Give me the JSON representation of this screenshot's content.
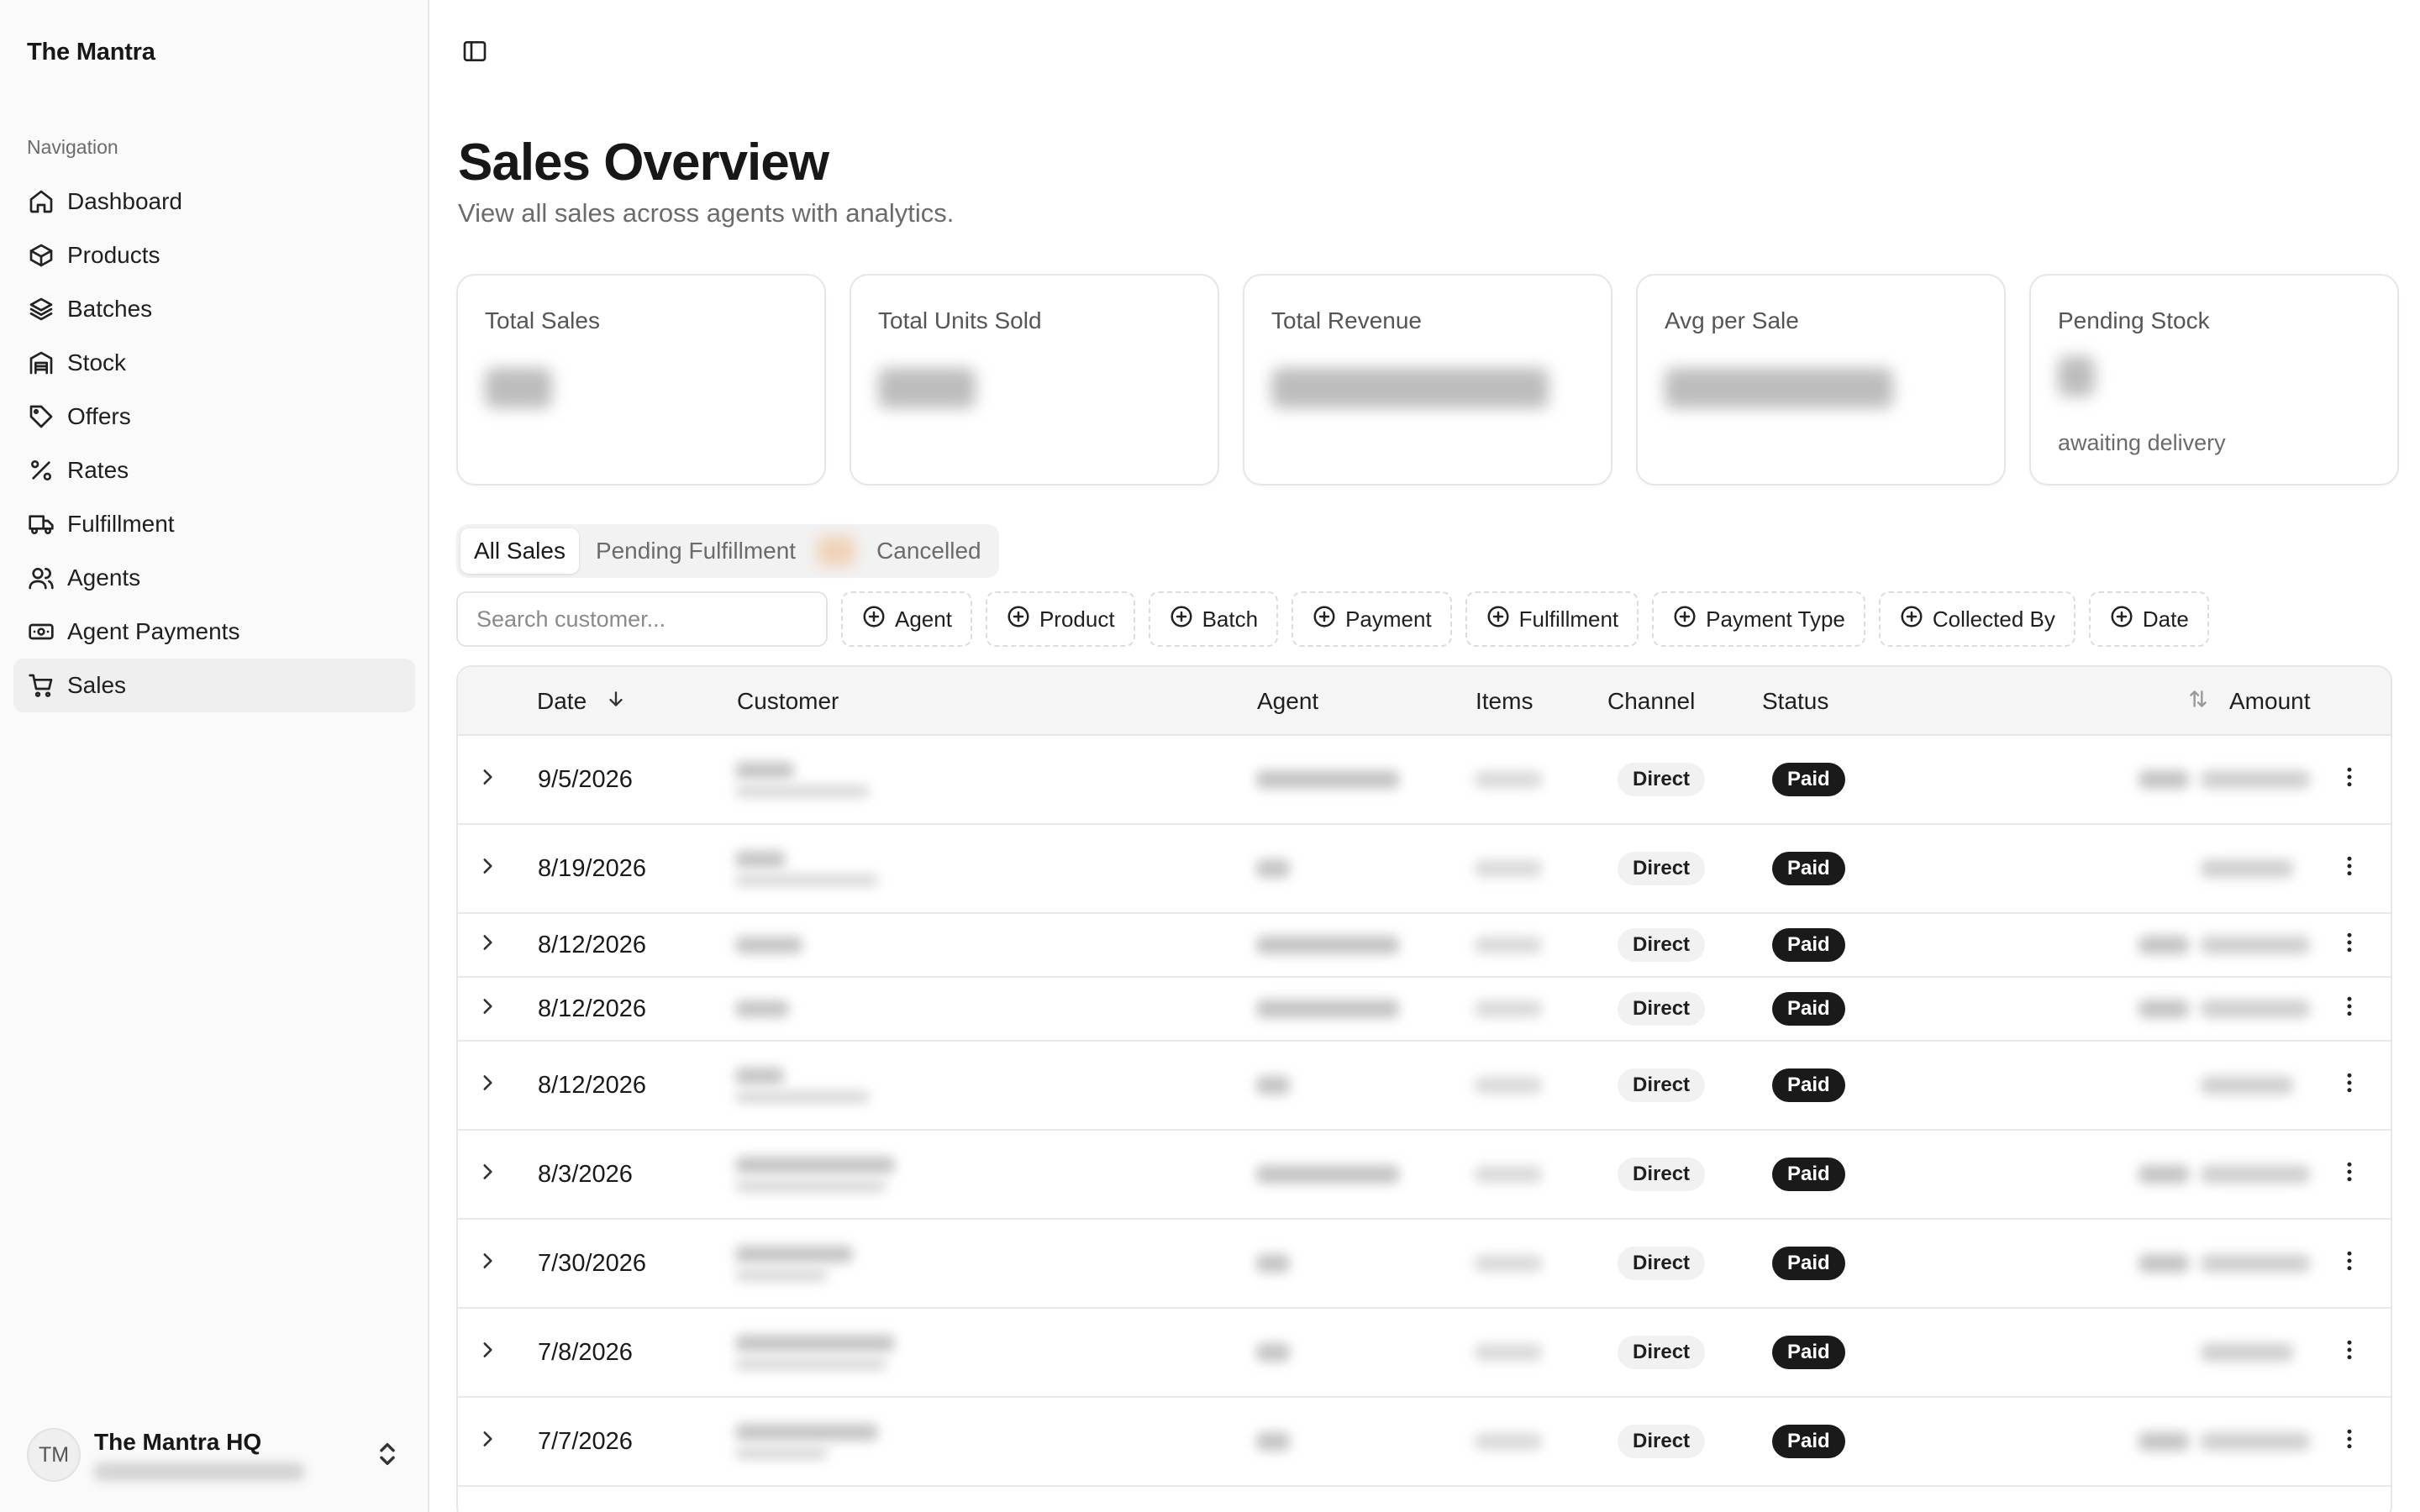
{
  "sidebar": {
    "brand": "The Mantra",
    "nav_heading": "Navigation",
    "items": [
      {
        "label": "Dashboard",
        "icon": "home-icon"
      },
      {
        "label": "Products",
        "icon": "box-icon"
      },
      {
        "label": "Batches",
        "icon": "layers-icon"
      },
      {
        "label": "Stock",
        "icon": "warehouse-icon"
      },
      {
        "label": "Offers",
        "icon": "tag-icon"
      },
      {
        "label": "Rates",
        "icon": "percent-icon"
      },
      {
        "label": "Fulfillment",
        "icon": "truck-icon"
      },
      {
        "label": "Agents",
        "icon": "users-icon"
      },
      {
        "label": "Agent Payments",
        "icon": "banknote-icon"
      },
      {
        "label": "Sales",
        "icon": "cart-icon",
        "active": true
      }
    ],
    "account": {
      "initials": "TM",
      "name": "The Mantra HQ"
    }
  },
  "header": {
    "title": "Sales Overview",
    "subtitle": "View all sales across agents with analytics."
  },
  "stats": [
    {
      "label": "Total Sales",
      "value_hidden": true,
      "note": ""
    },
    {
      "label": "Total Units Sold",
      "value_hidden": true,
      "note": ""
    },
    {
      "label": "Total Revenue",
      "value_hidden": true,
      "note": ""
    },
    {
      "label": "Avg per Sale",
      "value_hidden": true,
      "note": ""
    },
    {
      "label": "Pending Stock",
      "value_hidden": true,
      "note": "awaiting delivery"
    }
  ],
  "tabs": [
    {
      "label": "All Sales",
      "active": true
    },
    {
      "label": "Pending Fulfillment",
      "active": false
    },
    {
      "label": "Cancelled",
      "active": false
    }
  ],
  "search": {
    "placeholder": "Search customer..."
  },
  "filters": [
    "Agent",
    "Product",
    "Batch",
    "Payment",
    "Fulfillment",
    "Payment Type",
    "Collected By",
    "Date"
  ],
  "table": {
    "columns": {
      "date": "Date",
      "customer": "Customer",
      "agent": "Agent",
      "items": "Items",
      "channel": "Channel",
      "status": "Status",
      "amount": "Amount"
    },
    "rows": [
      {
        "date": "9/5/2026",
        "channel": "Direct",
        "status": "Paid"
      },
      {
        "date": "8/19/2026",
        "channel": "Direct",
        "status": "Paid"
      },
      {
        "date": "8/12/2026",
        "channel": "Direct",
        "status": "Paid"
      },
      {
        "date": "8/12/2026",
        "channel": "Direct",
        "status": "Paid"
      },
      {
        "date": "8/12/2026",
        "channel": "Direct",
        "status": "Paid"
      },
      {
        "date": "8/3/2026",
        "channel": "Direct",
        "status": "Paid"
      },
      {
        "date": "7/30/2026",
        "channel": "Direct",
        "status": "Paid"
      },
      {
        "date": "7/8/2026",
        "channel": "Direct",
        "status": "Paid"
      },
      {
        "date": "7/7/2026",
        "channel": "Direct",
        "status": "Paid"
      }
    ]
  },
  "colors": {
    "active_bg": "#efefef",
    "paid_badge": "#1a1a1a",
    "sidebar_bg": "#fafafa"
  }
}
